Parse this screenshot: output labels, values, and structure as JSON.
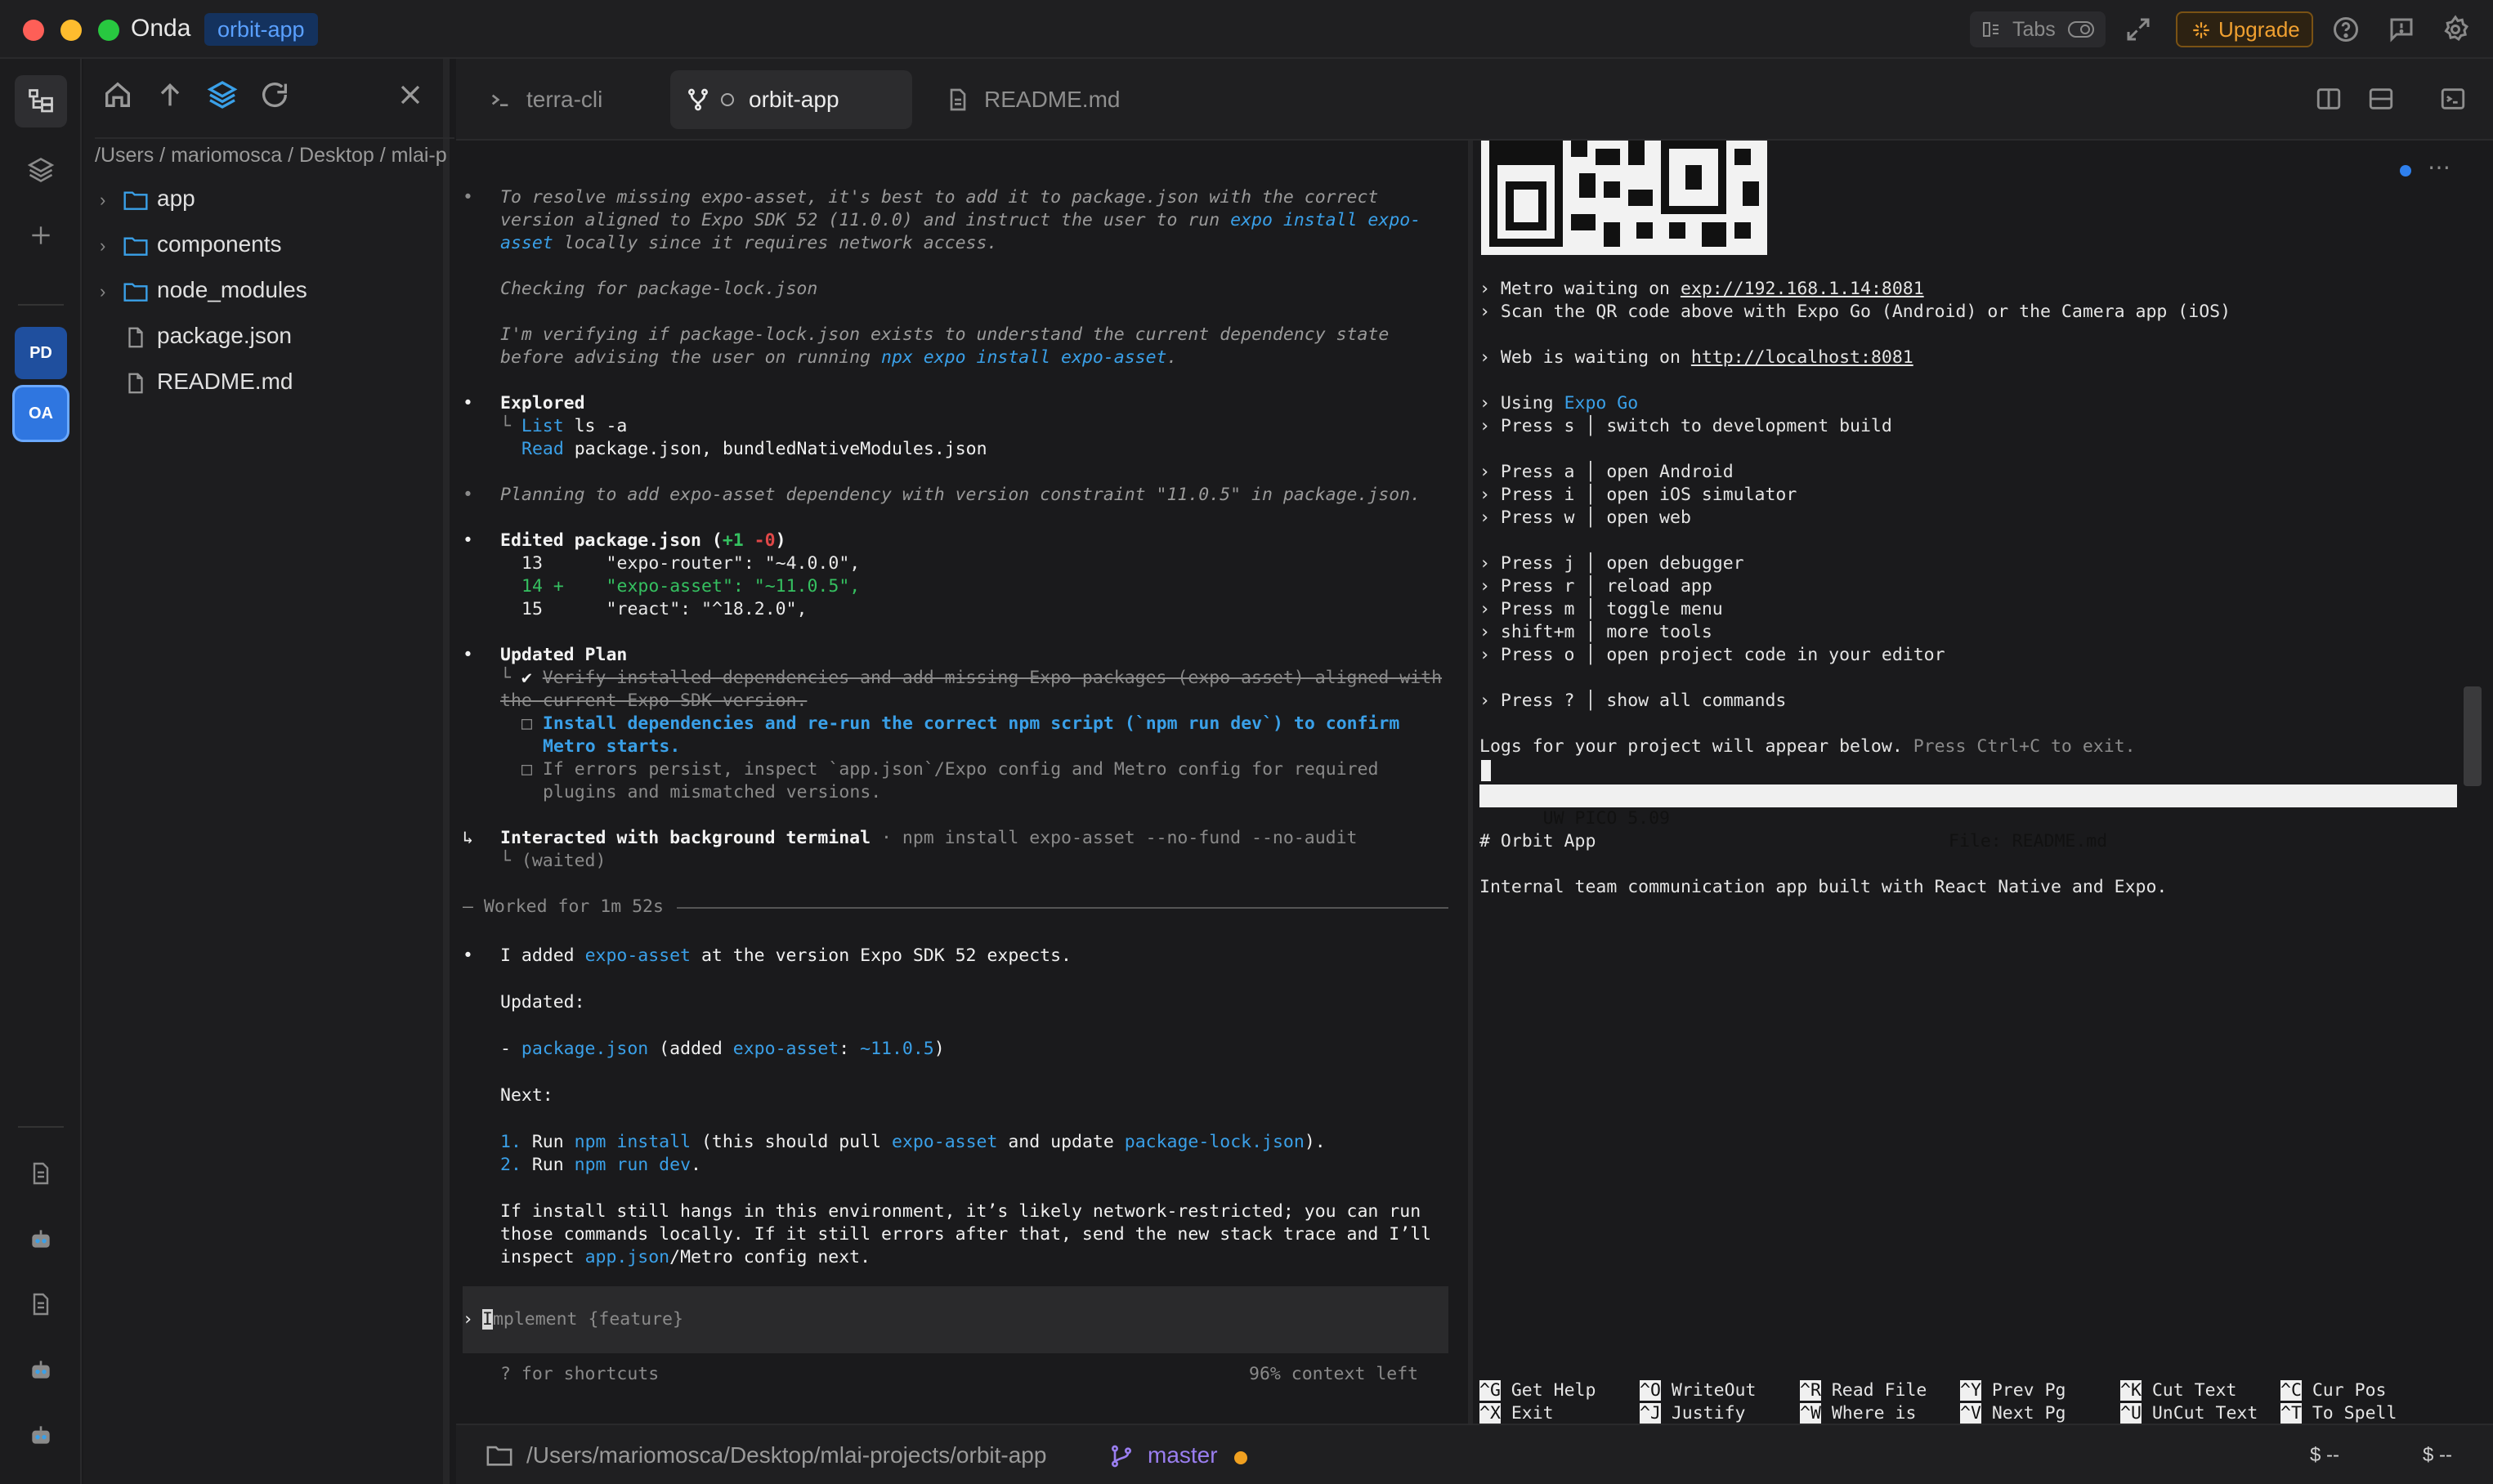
{
  "app": {
    "name": "Onda",
    "project_badge": "orbit-app"
  },
  "titlebar": {
    "tabs_label": "Tabs",
    "upgrade_label": "Upgrade"
  },
  "rail": {
    "avatars": [
      "PD",
      "OA"
    ]
  },
  "explorer": {
    "path": "/Users / mariomosca / Desktop / mlai-p",
    "items": [
      {
        "label": "app",
        "type": "folder"
      },
      {
        "label": "components",
        "type": "folder"
      },
      {
        "label": "node_modules",
        "type": "folder"
      },
      {
        "label": "package.json",
        "type": "file"
      },
      {
        "label": "README.md",
        "type": "file"
      }
    ]
  },
  "editor_tabs": [
    {
      "label": "terra-cli",
      "icon": "terminal-icon"
    },
    {
      "label": "orbit-app",
      "icon": "git-branch-icon"
    },
    {
      "label": "README.md",
      "icon": "file-icon"
    }
  ],
  "chat": {
    "l1": "To resolve missing expo-asset, it's best to add it to package.json with the correct",
    "l2a": "version aligned to Expo SDK 52 (11.0.0) and instruct the user to run ",
    "l2b": "expo install expo-",
    "l3a": "asset",
    "l3b": " locally since it requires network access.",
    "l4": "Checking for package-lock.json",
    "l5": "I'm verifying if package-lock.json exists to understand the current dependency state",
    "l6a": "before advising the user on running ",
    "l6b": "npx expo install expo-asset",
    "l6c": ".",
    "explored": "Explored",
    "list_kw": "List",
    "list_arg": " ls -a",
    "read_kw": "Read",
    "read_arg": " package.json, bundledNativeModules.json",
    "planning": "Planning to add expo-asset dependency with version constraint \"11.0.5\" in package.json.",
    "edited": "Edited package.json (",
    "plus": "+1",
    "minus": "-0",
    "close_paren": ")",
    "diff1": "13      \"expo-router\": \"~4.0.0\",",
    "diff2": "14 +    \"expo-asset\": \"~11.0.5\",",
    "diff3": "15      \"react\": \"^18.2.0\",",
    "updated_plan": "Updated Plan",
    "plan1a": "Verify installed dependencies and add missing Expo packages (expo-asset) aligned with",
    "plan1b": "the current Expo SDK version.",
    "plan2a": "Install dependencies and re-run the correct npm script (`npm run dev`) to confirm",
    "plan2b": "Metro starts.",
    "plan3a": "If errors persist, inspect `app.json`/Expo config and Metro config for required",
    "plan3b": "plugins and mismatched versions.",
    "interacted": "Interacted with background terminal",
    "interacted_cmd": " · npm install expo-asset --no-fund --no-audit",
    "waited": "(waited)",
    "worked": "Worked for 1m 52s",
    "added_a": "I added ",
    "added_b": "expo-asset",
    "added_c": " at the version Expo SDK 52 expects.",
    "updated": "Updated:",
    "upd_a": "- ",
    "upd_b": "package.json",
    "upd_c": " (added ",
    "upd_d": "expo-asset",
    "upd_e": ": ",
    "upd_f": "~11.0.5",
    "upd_g": ")",
    "next": "Next:",
    "n1a": "1. ",
    "n1b": "Run ",
    "n1c": "npm install",
    "n1d": " (this should pull ",
    "n1e": "expo-asset",
    "n1f": " and update ",
    "n1g": "package-lock.json",
    "n1h": ").",
    "n2a": "2. ",
    "n2b": "Run ",
    "n2c": "npm run dev",
    "n2d": ".",
    "if1": "If install still hangs in this environment, it’s likely network-restricted; you can run",
    "if2": "those commands locally. If it still errors after that, send the new stack trace and I’ll",
    "if3a": "inspect ",
    "if3b": "app.json",
    "if3c": "/Metro config next.",
    "prompt_placeholder": "mplement {feature}",
    "prompt_cursor": "I",
    "shortcuts": "? for shortcuts",
    "context": "96% context left"
  },
  "terminal": {
    "metro_a": "› Metro waiting on ",
    "metro_b": "exp://192.168.1.14:8081",
    "scan": "› Scan the QR code above with Expo Go (Android) or the Camera app (iOS)",
    "web_a": "› Web is waiting on ",
    "web_b": "http://localhost:8081",
    "using_a": "› Using ",
    "using_b": "Expo Go",
    "k_s": "› Press s │ switch to development build",
    "k_a": "› Press a │ open Android",
    "k_i": "› Press i │ open iOS simulator",
    "k_w": "› Press w │ open web",
    "k_j": "› Press j │ open debugger",
    "k_r": "› Press r │ reload app",
    "k_m": "› Press m │ toggle menu",
    "k_sm": "› shift+m │ more tools",
    "k_o": "› Press o │ open project code in your editor",
    "k_q": "› Press ? │ show all commands",
    "logs_a": "Logs for your project will appear below.",
    "logs_b": " Press Ctrl+C to exit.",
    "pico_version": "  UW PICO 5.09",
    "pico_file": "File: README.md",
    "readme_h": "# Orbit App",
    "readme_p": "Internal team communication app built with React Native and Expo.",
    "keys": [
      {
        "k1": "^G",
        "l1": "Get Help",
        "k2": "^X",
        "l2": "Exit"
      },
      {
        "k1": "^O",
        "l1": "WriteOut",
        "k2": "^J",
        "l2": "Justify"
      },
      {
        "k1": "^R",
        "l1": "Read File",
        "k2": "^W",
        "l2": "Where is"
      },
      {
        "k1": "^Y",
        "l1": "Prev Pg",
        "k2": "^V",
        "l2": "Next Pg"
      },
      {
        "k1": "^K",
        "l1": "Cut Text",
        "k2": "^U",
        "l2": "UnCut Text"
      },
      {
        "k1": "^C",
        "l1": "Cur Pos",
        "k2": "^T",
        "l2": "To Spell"
      }
    ]
  },
  "status": {
    "path": "/Users/mariomosca/Desktop/mlai-projects/orbit-app",
    "branch": "master",
    "right1": "$ --",
    "right2": "$ --"
  },
  "colors": {
    "accent": "#3aa0e8",
    "upgrade": "#f0a030",
    "dirty_dot": "#f0a020",
    "branch": "#9a7ef0"
  }
}
